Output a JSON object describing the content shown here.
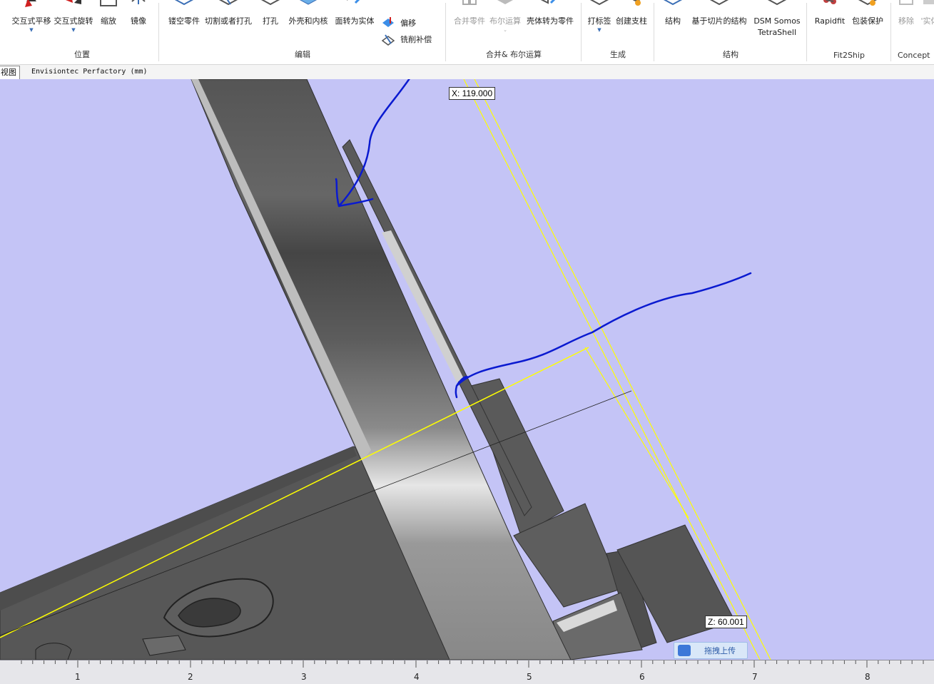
{
  "ribbon": {
    "groups": [
      {
        "label": "位置",
        "buttons": [
          {
            "label": "交互式平移",
            "icon": "move-arrows-icon",
            "dropdown": true,
            "disabled": false
          },
          {
            "label": "交互式旋转",
            "icon": "rotate-arrows-icon",
            "dropdown": true,
            "disabled": false
          },
          {
            "label": "缩放",
            "icon": "scale-box-icon",
            "dropdown": false,
            "disabled": false
          },
          {
            "label": "镜像",
            "icon": "mirror-icon",
            "dropdown": false,
            "disabled": false
          }
        ]
      },
      {
        "label": "编辑",
        "buttons": [
          {
            "label": "镂空零件",
            "icon": "hollow-part-icon",
            "disabled": false
          },
          {
            "label": "切割或者打孔",
            "icon": "cut-punch-icon",
            "disabled": false
          },
          {
            "label": "打孔",
            "icon": "perforate-icon",
            "disabled": false
          },
          {
            "label": "外壳和内核",
            "icon": "shell-core-icon",
            "disabled": false
          },
          {
            "label": "面转为实体",
            "icon": "surface-to-solid-icon",
            "disabled": false
          },
          {
            "label": "偏移",
            "icon": "offset-icon",
            "disabled": false
          },
          {
            "label": "铣削补偿",
            "icon": "milling-compensation-icon",
            "disabled": false
          }
        ]
      },
      {
        "label": "合并& 布尔运算",
        "buttons": [
          {
            "label": "合并零件",
            "icon": "merge-parts-icon",
            "disabled": true
          },
          {
            "label": "布尔运算",
            "icon": "boolean-icon",
            "disabled": true
          },
          {
            "label": "壳体转为零件",
            "icon": "shell-to-part-icon",
            "disabled": false
          }
        ]
      },
      {
        "label": "生成",
        "buttons": [
          {
            "label": "打标签",
            "icon": "label-icon",
            "disabled": false
          },
          {
            "label": "创建支柱",
            "icon": "create-pillar-icon",
            "disabled": false
          }
        ]
      },
      {
        "label": "结构",
        "buttons": [
          {
            "label": "结构",
            "icon": "structure-icon",
            "disabled": false
          },
          {
            "label": "基于切片的结构",
            "icon": "slice-structure-icon",
            "disabled": false
          },
          {
            "label": "DSM Somos TetraShell",
            "label_line1": "DSM Somos",
            "label_line2": "TetraShell",
            "icon": "tetrashell-icon",
            "disabled": false
          }
        ]
      },
      {
        "label": "Fit2Ship",
        "buttons": [
          {
            "label": "Rapidfit",
            "icon": "rapidfit-icon",
            "disabled": false
          },
          {
            "label": "包装保护",
            "icon": "package-protect-icon",
            "disabled": false
          }
        ]
      },
      {
        "label": "Concept",
        "buttons": [
          {
            "label": "移除",
            "icon": "remove-icon",
            "disabled": true
          },
          {
            "label": "'实体",
            "icon": "solid-icon",
            "disabled": true
          }
        ]
      }
    ]
  },
  "tabs": {
    "view": "视图",
    "machine": "Envisiontec Perfactory (mm)"
  },
  "viewport": {
    "x_readout": "X: 119.000",
    "z_readout": "Z: 60.001",
    "upload_label": "拖拽上传"
  },
  "ruler": {
    "labels": [
      "1",
      "2",
      "3",
      "4",
      "5",
      "6",
      "7",
      "8"
    ]
  },
  "colors": {
    "background": "#c4c4f6",
    "annotation_pen": "#0a1ad0",
    "guide_line": "#ffff00",
    "part_gray": "#5a5a5a"
  }
}
